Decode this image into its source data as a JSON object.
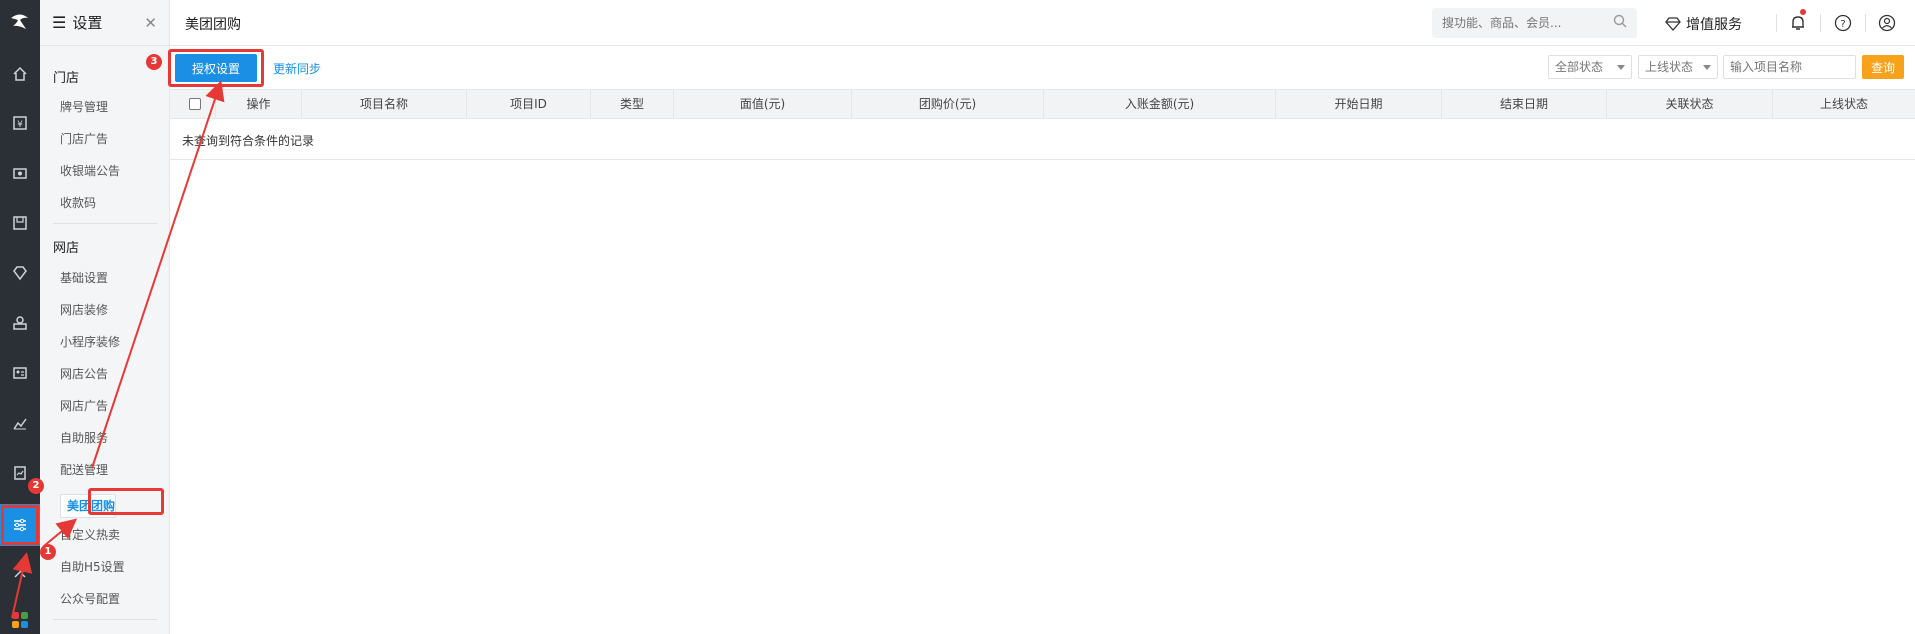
{
  "sidebar": {
    "title": "设置",
    "groups": [
      {
        "label": "门店",
        "items": [
          "牌号管理",
          "门店广告",
          "收银端公告",
          "收款码"
        ]
      },
      {
        "label": "网店",
        "items": [
          "基础设置",
          "网店装修",
          "小程序装修",
          "网店公告",
          "网店广告",
          "自助服务",
          "配送管理",
          "美团团购",
          "自定义热卖",
          "自助H5设置",
          "公众号配置"
        ]
      }
    ],
    "selected": "美团团购"
  },
  "header": {
    "title": "美团团购",
    "search_placeholder": "搜功能、商品、会员...",
    "value_added": "增值服务"
  },
  "toolbar": {
    "auth_button": "授权设置",
    "sync_link": "更新同步",
    "status_select": "全部状态",
    "online_select": "上线状态",
    "keyword_placeholder": "输入项目名称",
    "query_button": "查询"
  },
  "table": {
    "columns": [
      "操作",
      "项目名称",
      "项目ID",
      "类型",
      "面值(元)",
      "团购价(元)",
      "入账金额(元)",
      "开始日期",
      "结束日期",
      "关联状态",
      "上线状态"
    ],
    "empty_text": "未查询到符合条件的记录"
  },
  "annotations": [
    "1",
    "2",
    "3"
  ],
  "colors": {
    "accent": "#1a8fe3",
    "highlight": "#e53935",
    "query": "#f7a21b",
    "rail": "#2b2f36"
  }
}
